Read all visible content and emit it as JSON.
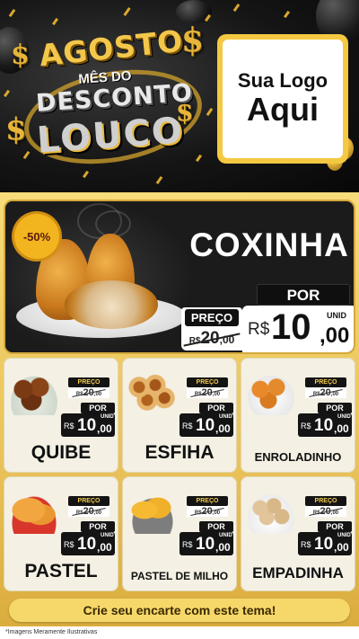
{
  "header": {
    "title_line1": "AGOSTO",
    "title_line2": "MÊS DO",
    "title_line3": "DESCONTO",
    "title_line4": "LOUCO",
    "logo_line1": "Sua Logo",
    "logo_line2": "Aqui",
    "dollar_symbol": "$"
  },
  "featured": {
    "discount_badge": "-50%",
    "name": "COXINHA",
    "old_price_label": "PREÇO",
    "old_price_currency": "R$",
    "old_price_int": "20",
    "old_price_cents": ",00",
    "new_price_label": "POR",
    "new_price_currency": "R$",
    "new_price_int": "10",
    "new_price_cents": ",00",
    "unit": "UNID"
  },
  "products": [
    {
      "name": "QUIBE",
      "old_label": "PREÇO",
      "old_currency": "R$",
      "old_int": "20",
      "old_cents": ",00",
      "new_label": "POR",
      "new_currency": "R$",
      "new_int": "10",
      "new_cents": ",00",
      "unit": "UNID"
    },
    {
      "name": "ESFIHA",
      "old_label": "PREÇO",
      "old_currency": "R$",
      "old_int": "20",
      "old_cents": ",00",
      "new_label": "POR",
      "new_currency": "R$",
      "new_int": "10",
      "new_cents": ",00",
      "unit": "UNID"
    },
    {
      "name": "ENROLADINHO",
      "old_label": "PREÇO",
      "old_currency": "R$",
      "old_int": "20",
      "old_cents": ",00",
      "new_label": "POR",
      "new_currency": "R$",
      "new_int": "10",
      "new_cents": ",00",
      "unit": "UNID"
    },
    {
      "name": "PASTEL",
      "old_label": "PREÇO",
      "old_currency": "R$",
      "old_int": "20",
      "old_cents": ",00",
      "new_label": "POR",
      "new_currency": "R$",
      "new_int": "10",
      "new_cents": ",00",
      "unit": "UNID"
    },
    {
      "name": "PASTEL DE MILHO",
      "old_label": "PREÇO",
      "old_currency": "R$",
      "old_int": "20",
      "old_cents": ",00",
      "new_label": "POR",
      "new_currency": "R$",
      "new_int": "10",
      "new_cents": ",00",
      "unit": "UNID"
    },
    {
      "name": "EMPADINHA",
      "old_label": "PREÇO",
      "old_currency": "R$",
      "old_int": "20",
      "old_cents": ",00",
      "new_label": "POR",
      "new_currency": "R$",
      "new_int": "10",
      "new_cents": ",00",
      "unit": "UNID"
    }
  ],
  "footer": {
    "cta": "Crie seu encarte com este tema!",
    "disclaimer": "*Imagens Meramente Ilustrativas"
  },
  "colors": {
    "gold": "#f5c842",
    "dark": "#141414",
    "panel": "#f1d068"
  }
}
